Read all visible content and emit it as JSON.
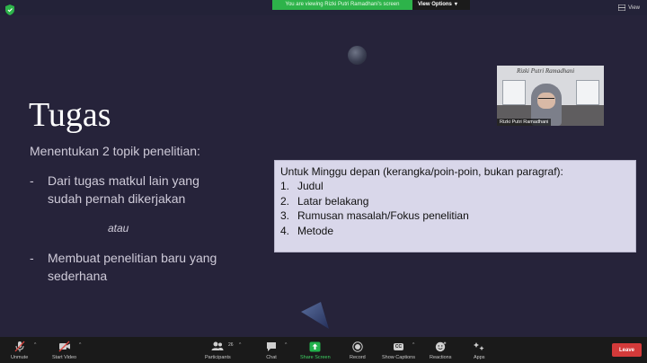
{
  "banner": {
    "viewing_text": "You are viewing Rizki Putri Ramadhani's screen",
    "view_options_label": "View Options"
  },
  "view_button_label": "View",
  "slide": {
    "title": "Tugas",
    "subtitle": "Menentukan 2 topik penelitian:",
    "items": [
      {
        "dash": "-",
        "text": "Dari tugas matkul lain yang sudah pernah dikerjakan"
      },
      {
        "dash": "-",
        "text": "Membuat penelitian baru yang sederhana"
      }
    ],
    "separator": "atau"
  },
  "video": {
    "background_sign": "Rizki Putri Ramadhani",
    "participant_name": "Rizki Putri Ramadhani"
  },
  "note": {
    "heading": "Untuk Minggu depan (kerangka/poin-poin, bukan paragraf):",
    "items": [
      {
        "num": "1.",
        "text": "Judul"
      },
      {
        "num": "2.",
        "text": "Latar belakang"
      },
      {
        "num": "3.",
        "text": "Rumusan masalah/Fokus penelitian"
      },
      {
        "num": "4.",
        "text": "Metode"
      }
    ]
  },
  "toolbar": {
    "unmute": "Unmute",
    "start_video": "Start Video",
    "participants": "Participants",
    "participants_count": "26",
    "chat": "Chat",
    "share_screen": "Share Screen",
    "record": "Record",
    "show_captions": "Show Captions",
    "cc_badge": "CC",
    "reactions": "Reactions",
    "apps": "Apps",
    "leave": "Leave"
  },
  "colors": {
    "banner_green": "#2db34a",
    "leave_red": "#d33a3a",
    "share_green": "#22b24c",
    "slide_bg": "#26233a"
  }
}
